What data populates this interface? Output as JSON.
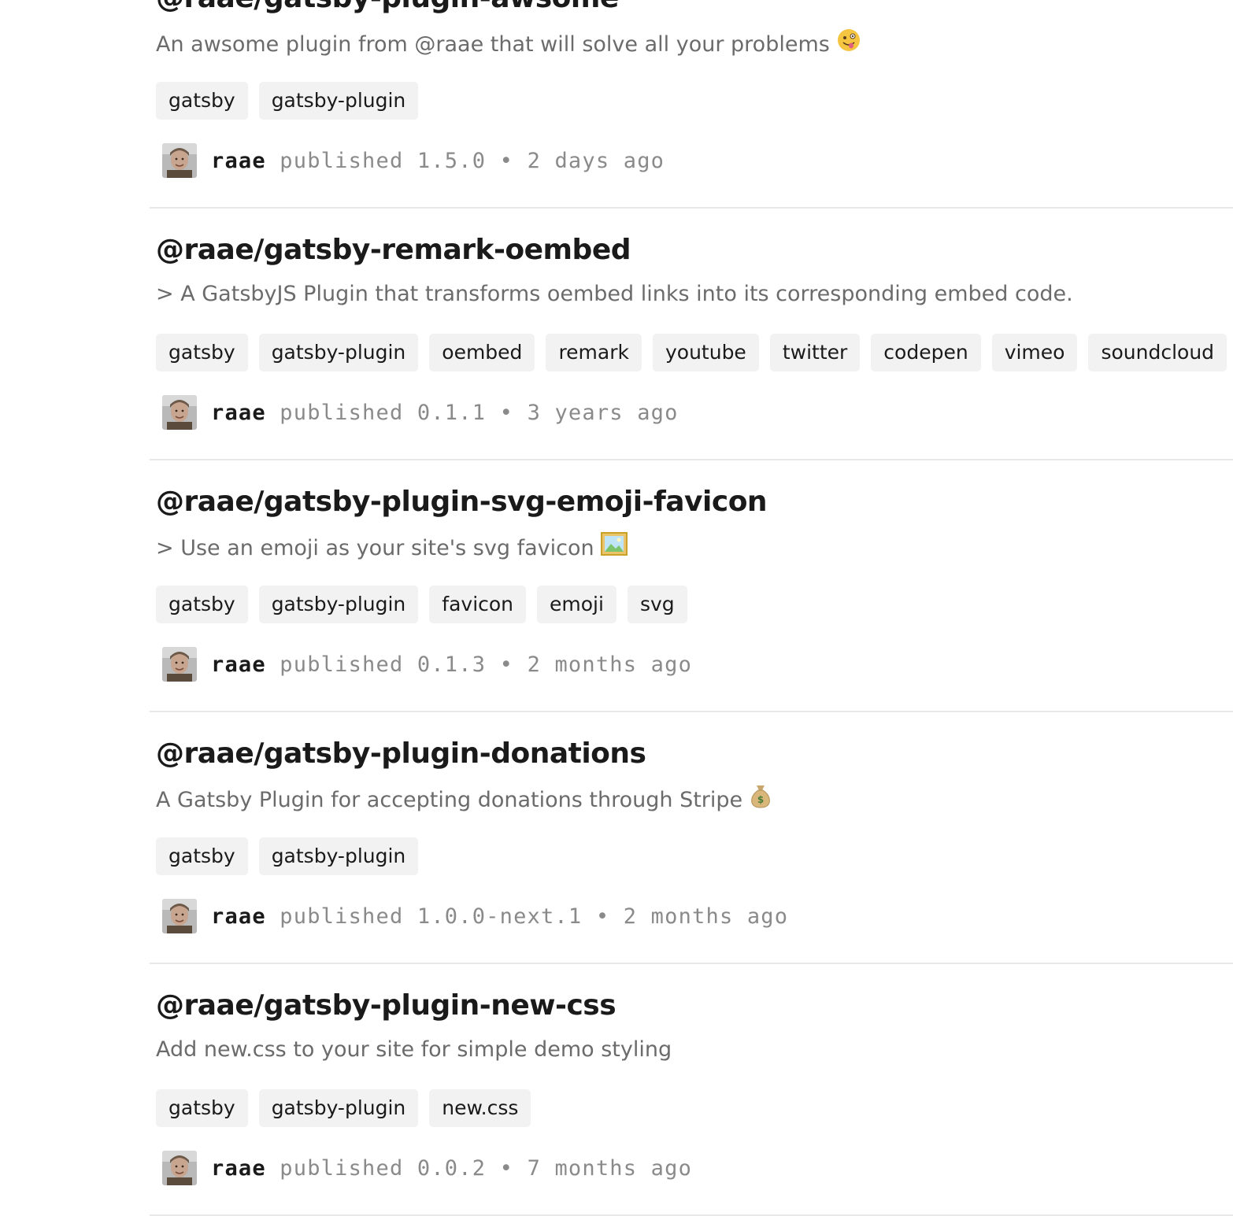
{
  "packages": [
    {
      "name": "@raae/gatsby-plugin-awsome",
      "description": "An awsome plugin from @raae that will solve all your problems",
      "description_emoji": "zany-face-icon",
      "tags": [
        "gatsby",
        "gatsby-plugin"
      ],
      "publisher": "raae",
      "published_label": "published",
      "version": "1.5.0",
      "separator": "•",
      "when": "2 days ago"
    },
    {
      "name": "@raae/gatsby-remark-oembed",
      "description": "> A GatsbyJS Plugin that transforms oembed links into its corresponding embed code.",
      "tags": [
        "gatsby",
        "gatsby-plugin",
        "oembed",
        "remark",
        "youtube",
        "twitter",
        "codepen",
        "vimeo",
        "soundcloud"
      ],
      "publisher": "raae",
      "published_label": "published",
      "version": "0.1.1",
      "separator": "•",
      "when": "3 years ago"
    },
    {
      "name": "@raae/gatsby-plugin-svg-emoji-favicon",
      "description": "> Use an emoji as your site's svg favicon",
      "description_emoji": "framed-picture-icon",
      "tags": [
        "gatsby",
        "gatsby-plugin",
        "favicon",
        "emoji",
        "svg"
      ],
      "publisher": "raae",
      "published_label": "published",
      "version": "0.1.3",
      "separator": "•",
      "when": "2 months ago"
    },
    {
      "name": "@raae/gatsby-plugin-donations",
      "description": "A Gatsby Plugin for accepting donations through Stripe",
      "description_emoji": "money-bag-icon",
      "tags": [
        "gatsby",
        "gatsby-plugin"
      ],
      "publisher": "raae",
      "published_label": "published",
      "version": "1.0.0-next.1",
      "separator": "•",
      "when": "2 months ago"
    },
    {
      "name": "@raae/gatsby-plugin-new-css",
      "description": "Add new.css to your site for simple demo styling",
      "tags": [
        "gatsby",
        "gatsby-plugin",
        "new.css"
      ],
      "publisher": "raae",
      "published_label": "published",
      "version": "0.0.2",
      "separator": "•",
      "when": "7 months ago"
    }
  ],
  "colors": {
    "text": "#1a1a1a",
    "muted": "#6b6b6b",
    "meta": "#8a8a8a",
    "tag_bg": "#f2f2f2",
    "divider": "#e8e8e8"
  }
}
